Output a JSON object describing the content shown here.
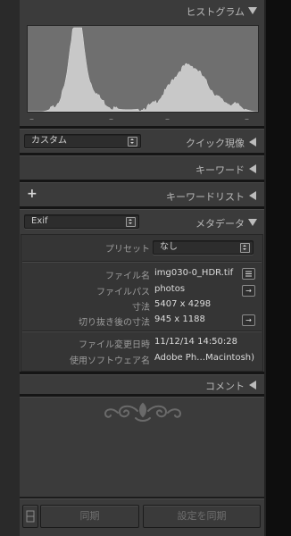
{
  "histogram": {
    "title": "ヒストグラム",
    "ticks": [
      "–",
      "–",
      "–",
      "–"
    ]
  },
  "quick_develop": {
    "preset_value": "カスタム",
    "title": "クイック現像"
  },
  "keywords": {
    "title": "キーワード"
  },
  "keyword_list": {
    "add_label": "+",
    "title": "キーワードリスト"
  },
  "metadata": {
    "set_value": "Exif",
    "title": "メタデータ",
    "preset_label": "プリセット",
    "preset_value": "なし",
    "rows": [
      {
        "label": "ファイル名",
        "value": "img030-0_HDR.tif",
        "button": "list-icon"
      },
      {
        "label": "ファイルパス",
        "value": "photos",
        "button": "arrow-right-icon"
      },
      {
        "label": "寸法",
        "value": "5407 x 4298"
      },
      {
        "label": "切り抜き後の寸法",
        "value": "945 x 1188",
        "button": "arrow-right-icon"
      },
      {
        "label": "ファイル変更日時",
        "value": "11/12/14 14:50:28"
      },
      {
        "label": "使用ソフトウェア名",
        "value": "Adobe Ph…Macintosh)"
      }
    ],
    "arrow_glyph": "→"
  },
  "comments": {
    "title": "コメント"
  },
  "bottom": {
    "sync_metadata_label": "同期",
    "sync_settings_label": "設定を同期"
  },
  "colors": {
    "panel_bg": "#3b3b3b",
    "histogram_fill": "#c8c8c8",
    "text": "#c9c9c9"
  }
}
